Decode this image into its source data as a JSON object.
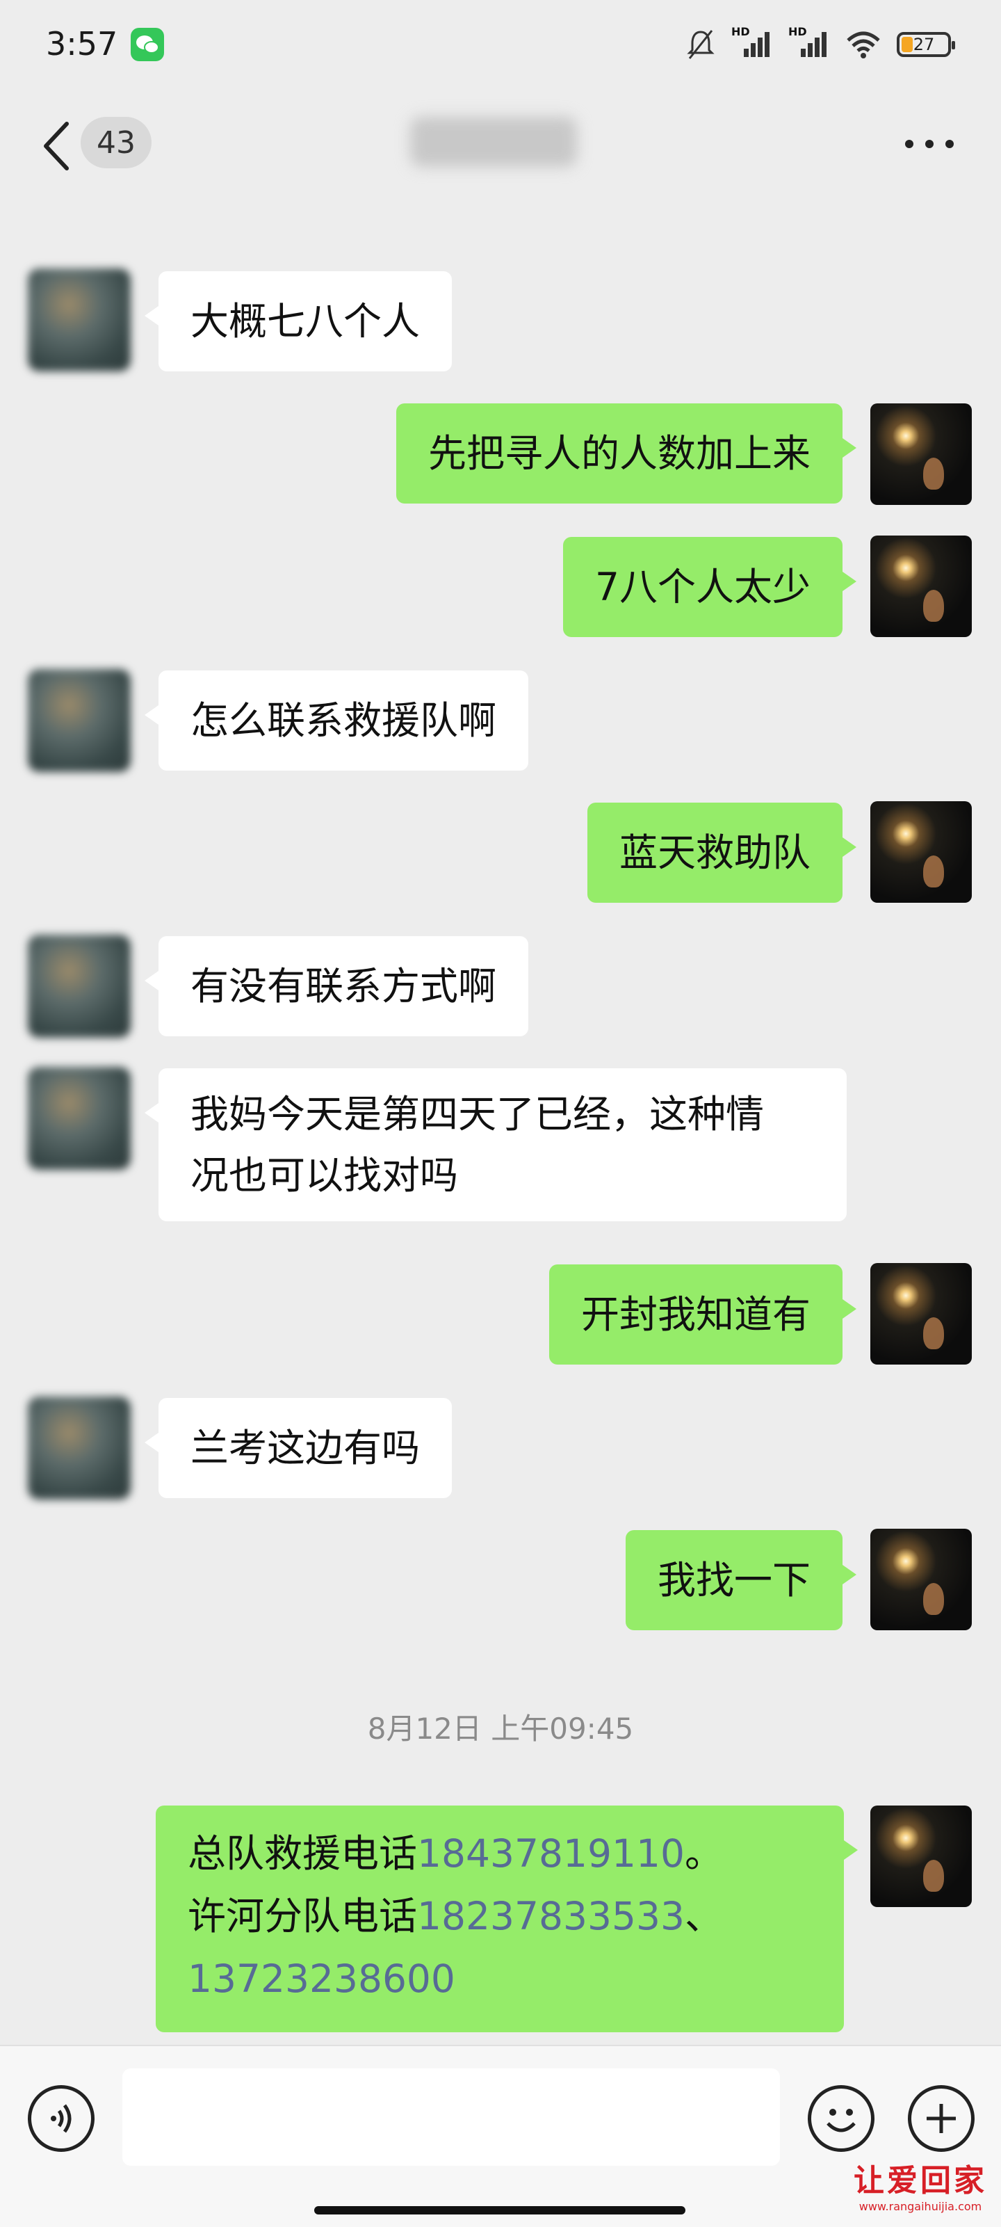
{
  "status_bar": {
    "time": "3:57",
    "battery": "27",
    "signal_label_1": "HD",
    "signal_label_2": "HD"
  },
  "header": {
    "unread_count": "43"
  },
  "messages": [
    {
      "side": "in",
      "text": "大概七八个人"
    },
    {
      "side": "out",
      "text": "先把寻人的人数加上来"
    },
    {
      "side": "out",
      "text": "7八个人太少"
    },
    {
      "side": "in",
      "text": "怎么联系救援队啊"
    },
    {
      "side": "out",
      "text": "蓝天救助队"
    },
    {
      "side": "in",
      "text": "有没有联系方式啊"
    },
    {
      "side": "in",
      "text_line1": "我妈今天是第四天了已经，这种情",
      "text_line2": "况也可以找对吗"
    },
    {
      "side": "out",
      "text": "开封我知道有"
    },
    {
      "side": "in",
      "text": "兰考这边有吗"
    },
    {
      "side": "out",
      "text": "我找一下"
    }
  ],
  "timestamp": "8月12日 上午09:45",
  "last_message": {
    "line1_prefix": "总队救援电话",
    "line1_phone": "18437819110",
    "line1_suffix": "。",
    "line2_prefix": "许河分队电话",
    "line2_phone": "18237833533",
    "line2_suffix": "、",
    "line3_phone": "13723238600"
  },
  "watermark": {
    "main": "让爱回家",
    "sub": "www.rangaihuijia.com"
  },
  "colors": {
    "background": "#ededed",
    "outgoing_bubble": "#95ec69",
    "incoming_bubble": "#ffffff",
    "link": "#576b95"
  }
}
